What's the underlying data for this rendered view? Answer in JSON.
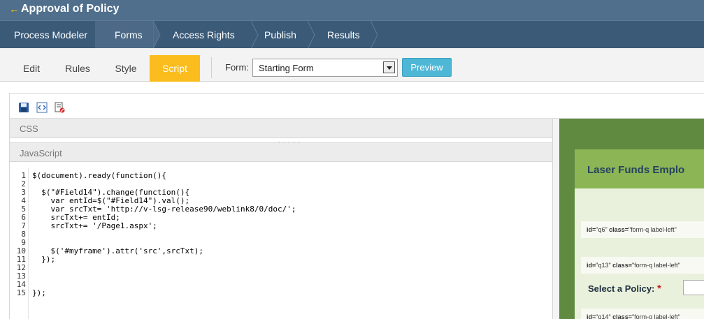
{
  "header": {
    "back_icon": "arrow-left-icon",
    "title": "Approval of Policy"
  },
  "nav": {
    "items": [
      {
        "label": "Process Modeler"
      },
      {
        "label": "Forms"
      },
      {
        "label": "Access Rights"
      },
      {
        "label": "Publish"
      },
      {
        "label": "Results"
      }
    ],
    "active": "Forms"
  },
  "toolbar": {
    "tabs": [
      {
        "label": "Edit"
      },
      {
        "label": "Rules"
      },
      {
        "label": "Style"
      },
      {
        "label": "Script"
      }
    ],
    "active_tab": "Script",
    "form_label": "Form:",
    "form_value": "Starting Form",
    "preview_label": "Preview",
    "colors": {
      "active_tab": "#fbbd1e",
      "preview_button": "#4fb7d6"
    }
  },
  "editor": {
    "icons": [
      "save-icon",
      "code-icon",
      "clear-icon"
    ],
    "css_label": "CSS",
    "js_label": "JavaScript",
    "line_numbers": [
      "1",
      "2",
      "3",
      "4",
      "5",
      "6",
      "7",
      "8",
      "9",
      "10",
      "11",
      "12",
      "13",
      "14",
      "15"
    ],
    "lines": [
      "$(document).ready(function(){",
      "",
      "  $(\"#Field14\").change(function(){",
      "    var entId=$(\"#Field14\").val();",
      "    var srcTxt= 'http://v-lsg-release90/weblink8/0/doc/';",
      "    srcTxt+= entId;",
      "    srcTxt+= '/Page1.aspx';",
      "",
      "",
      "    $('#myframe').attr('src',srcTxt);",
      "  });",
      "",
      "",
      "",
      "});"
    ]
  },
  "preview": {
    "heading": "Laser Funds Emplo",
    "chips": [
      {
        "id_attr": "id=",
        "id_val": "\"q6\"",
        "class_attr": " class=",
        "class_val": "\"form-q label-left\""
      },
      {
        "id_attr": "id=",
        "id_val": "\"q13\"",
        "class_attr": " class=",
        "class_val": "\"form-q label-left\""
      },
      {
        "id_attr": "id=",
        "id_val": "\"q14\"",
        "class_attr": " class=",
        "class_val": "\"form-q label-left\""
      }
    ],
    "field_label": "Select a Policy:",
    "required_mark": "*"
  }
}
